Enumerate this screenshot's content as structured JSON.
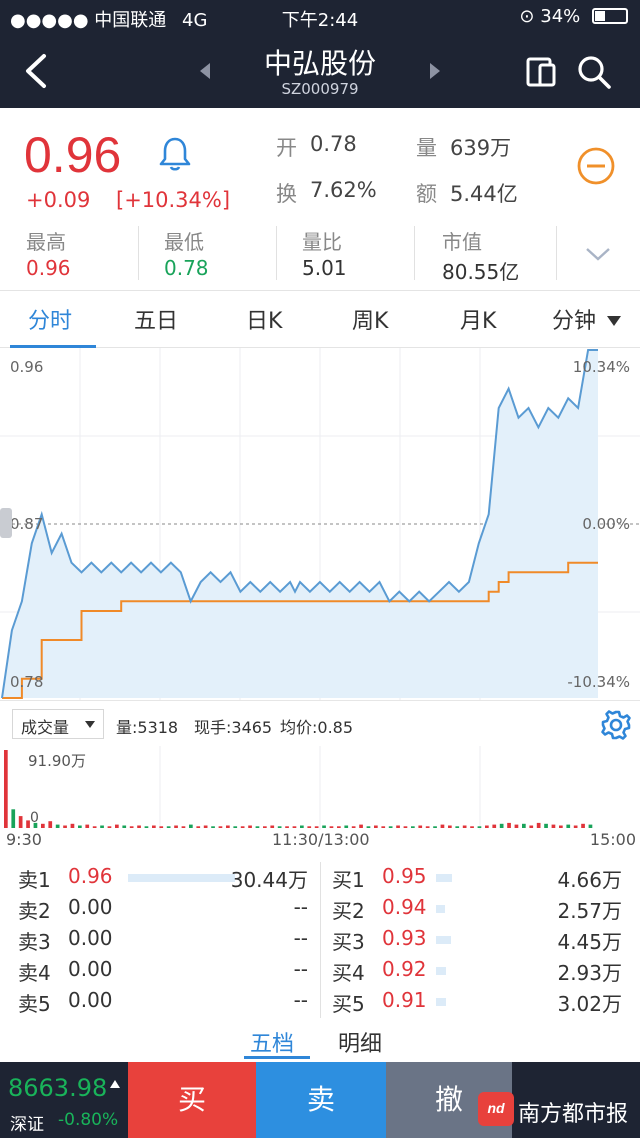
{
  "status_bar": {
    "carrier": "中国联通",
    "network": "4G",
    "time": "下午2:44",
    "battery": "34%",
    "battery_level": 0.34
  },
  "header": {
    "title": "中弘股份",
    "code": "SZ000979"
  },
  "quote": {
    "price": "0.96",
    "change": "+0.09",
    "change_pct": "[+10.34%]",
    "open_label": "开",
    "open": "0.78",
    "turnover_label": "换",
    "turnover": "7.62%",
    "volume_label": "量",
    "volume": "639万",
    "amount_label": "额",
    "amount": "5.44亿"
  },
  "stats": [
    {
      "label": "最高",
      "value": "0.96",
      "color": "#e0343a"
    },
    {
      "label": "最低",
      "value": "0.78",
      "color": "#19a35a"
    },
    {
      "label": "量比",
      "value": "5.01",
      "color": "#333333"
    },
    {
      "label": "市值",
      "value": "80.55亿",
      "color": "#333333"
    }
  ],
  "tabs": [
    {
      "label": "分时",
      "active": true
    },
    {
      "label": "五日",
      "active": false
    },
    {
      "label": "日K",
      "active": false
    },
    {
      "label": "周K",
      "active": false
    },
    {
      "label": "月K",
      "active": false
    },
    {
      "label": "分钟",
      "active": false
    }
  ],
  "chart_data": {
    "type": "line",
    "price_labels": {
      "top": "0.96",
      "mid": "0.87",
      "bottom": "0.78"
    },
    "pct_labels": {
      "top": "10.34%",
      "mid": "0.00%",
      "bottom": "-10.34%"
    },
    "ylim": [
      0.78,
      0.96
    ],
    "time_labels": [
      "9:30",
      "11:30/13:00",
      "15:00"
    ],
    "series": [
      {
        "role": "price",
        "color": "#5a9bd3",
        "x": [
          0,
          4,
          8,
          12,
          16,
          20,
          24,
          28,
          32,
          36,
          40,
          44,
          48,
          52,
          56,
          60,
          64,
          68,
          72,
          76,
          80,
          84,
          88,
          92,
          96,
          100,
          104,
          108,
          112,
          116,
          118,
          120,
          124,
          128,
          132,
          136,
          140,
          144,
          148,
          152,
          156,
          160,
          164,
          168,
          172,
          176,
          180,
          184,
          188,
          192,
          196,
          200,
          204,
          208,
          212,
          216,
          220,
          224,
          228,
          232,
          236,
          240
        ],
        "values": [
          0.78,
          0.815,
          0.83,
          0.86,
          0.875,
          0.855,
          0.865,
          0.85,
          0.845,
          0.85,
          0.845,
          0.85,
          0.845,
          0.85,
          0.845,
          0.85,
          0.845,
          0.85,
          0.845,
          0.83,
          0.84,
          0.845,
          0.84,
          0.845,
          0.835,
          0.84,
          0.835,
          0.84,
          0.835,
          0.84,
          0.835,
          0.84,
          0.835,
          0.84,
          0.835,
          0.84,
          0.835,
          0.84,
          0.835,
          0.84,
          0.83,
          0.835,
          0.83,
          0.835,
          0.83,
          0.835,
          0.84,
          0.835,
          0.84,
          0.86,
          0.875,
          0.93,
          0.94,
          0.925,
          0.93,
          0.92,
          0.93,
          0.925,
          0.935,
          0.93,
          0.96,
          0.96
        ]
      },
      {
        "role": "average",
        "color": "#f08a28",
        "x": [
          0,
          8,
          16,
          32,
          48,
          80,
          120,
          160,
          192,
          196,
          200,
          204,
          220,
          228,
          236,
          240
        ],
        "values": [
          0.78,
          0.79,
          0.81,
          0.825,
          0.83,
          0.83,
          0.83,
          0.83,
          0.83,
          0.835,
          0.84,
          0.845,
          0.845,
          0.85,
          0.85,
          0.85
        ]
      }
    ],
    "volume": {
      "max_label": "91.90万",
      "zero_label": "0",
      "color": "#e0343a",
      "alt_color": "#19a35a",
      "values": [
        91.9,
        22,
        14,
        9,
        6,
        5,
        8,
        4,
        3,
        5,
        3,
        4,
        2,
        3,
        2,
        4,
        3,
        2,
        3,
        2,
        3,
        2,
        2,
        3,
        2,
        4,
        2,
        3,
        2,
        2,
        3,
        2,
        2,
        3,
        2,
        2,
        3,
        2,
        2,
        2,
        3,
        2,
        2,
        3,
        2,
        2,
        3,
        2,
        4,
        2,
        3,
        2,
        2,
        3,
        2,
        2,
        3,
        2,
        2,
        4,
        3,
        2,
        3,
        2,
        2,
        3,
        4,
        5,
        6,
        4,
        5,
        3,
        6,
        5,
        4,
        3,
        4,
        3,
        5,
        4
      ]
    }
  },
  "volume_toolbar": {
    "select_label": "成交量",
    "vol": "量:5318",
    "hand": "现手:3465",
    "avg": "均价:0.85"
  },
  "order_book": {
    "sell": [
      {
        "label": "卖1",
        "price": "0.96",
        "amount": "30.44万",
        "bar": 0.85
      },
      {
        "label": "卖2",
        "price": "0.00",
        "amount": "--",
        "bar": 0
      },
      {
        "label": "卖3",
        "price": "0.00",
        "amount": "--",
        "bar": 0
      },
      {
        "label": "卖4",
        "price": "0.00",
        "amount": "--",
        "bar": 0
      },
      {
        "label": "卖5",
        "price": "0.00",
        "amount": "--",
        "bar": 0
      }
    ],
    "buy": [
      {
        "label": "买1",
        "price": "0.95",
        "amount": "4.66万",
        "bar": 0.13
      },
      {
        "label": "买2",
        "price": "0.94",
        "amount": "2.57万",
        "bar": 0.07
      },
      {
        "label": "买3",
        "price": "0.93",
        "amount": "4.45万",
        "bar": 0.12
      },
      {
        "label": "买4",
        "price": "0.92",
        "amount": "2.93万",
        "bar": 0.08
      },
      {
        "label": "买5",
        "price": "0.91",
        "amount": "3.02万",
        "bar": 0.08
      }
    ],
    "price_color": "#e0343a",
    "zero_color": "#333333"
  },
  "sub_tabs": [
    {
      "label": "五档",
      "active": true
    },
    {
      "label": "明细",
      "active": false
    }
  ],
  "bottom": {
    "index_value": "8663.98",
    "index_name": "深证",
    "index_change": "-0.80%",
    "buy": "买",
    "sell": "卖",
    "cancel": "撤"
  },
  "watermark": {
    "logo": "nd",
    "text": "南方都市报"
  }
}
